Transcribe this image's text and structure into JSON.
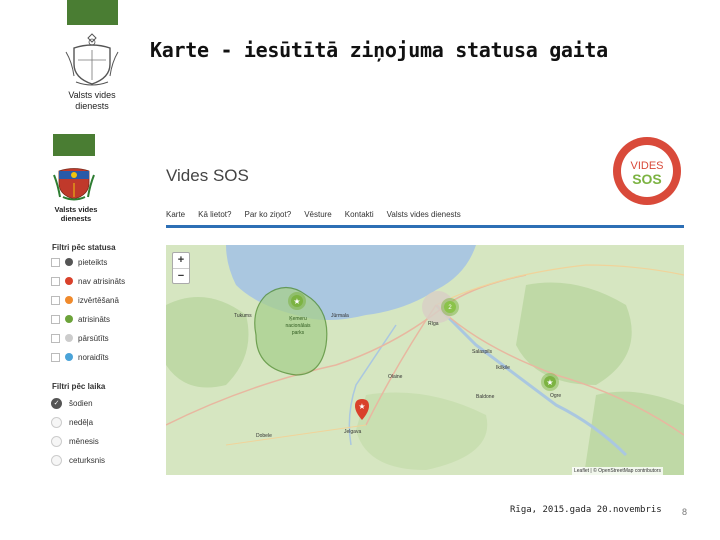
{
  "slide": {
    "title": "Karte - iesūtītā ziņojuma statusa gaita",
    "org_name_line1": "Valsts vides",
    "org_name_line2": "dienests",
    "footer_date": "Rīga, 2015.gada 20.novembris",
    "page_number": "8"
  },
  "app": {
    "title": "Vides SOS",
    "logo_text_top": "VIDES",
    "logo_text_bottom": "SOS",
    "sidebar_org_line1": "Valsts vides",
    "sidebar_org_line2": "dienests",
    "nav": [
      "Karte",
      "Kā lietot?",
      "Par ko ziņot?",
      "Vēsture",
      "Kontakti",
      "Valsts vides dienests"
    ],
    "status_filter_title": "Filtri pēc statusa",
    "status_filters": [
      {
        "label": "pieteikts",
        "color": "#555555"
      },
      {
        "label": "nav atrisināts",
        "color": "#d9412b"
      },
      {
        "label": "izvērtēšanā",
        "color": "#f08a2c"
      },
      {
        "label": "atrisināts",
        "color": "#6ca33a"
      },
      {
        "label": "pārsūtīts",
        "color": "#cccccc"
      },
      {
        "label": "noraidīts",
        "color": "#4aa3d8"
      }
    ],
    "time_filter_title": "Filtri pēc laika",
    "time_filters": [
      {
        "label": "šodien",
        "selected": true
      },
      {
        "label": "nedēļa",
        "selected": false
      },
      {
        "label": "mēnesis",
        "selected": false
      },
      {
        "label": "ceturksnis",
        "selected": false
      }
    ]
  },
  "map": {
    "zoom_in": "+",
    "zoom_out": "−",
    "attribution": "Leaflet | © OpenStreetMap contributors",
    "cluster_count": "2",
    "area_label_1": "Ķemeru",
    "area_label_2": "nacionālais",
    "area_label_3": "parks",
    "places": [
      "Jūrmala",
      "Rīga",
      "Ogre",
      "Jelgava",
      "Salaspils",
      "Olaine",
      "Baldone",
      "Dobele",
      "Tukums",
      "Ikšķile"
    ],
    "marker_colors": {
      "resolved": "#7cb342",
      "unresolved": "#d9412b",
      "water": "#aac7e0",
      "park": "#a8d08d"
    }
  },
  "colors": {
    "brand_green": "#4a7d33",
    "nav_blue": "#2d6fb5",
    "logo_red": "#d94a3a",
    "logo_green": "#7cb342"
  }
}
